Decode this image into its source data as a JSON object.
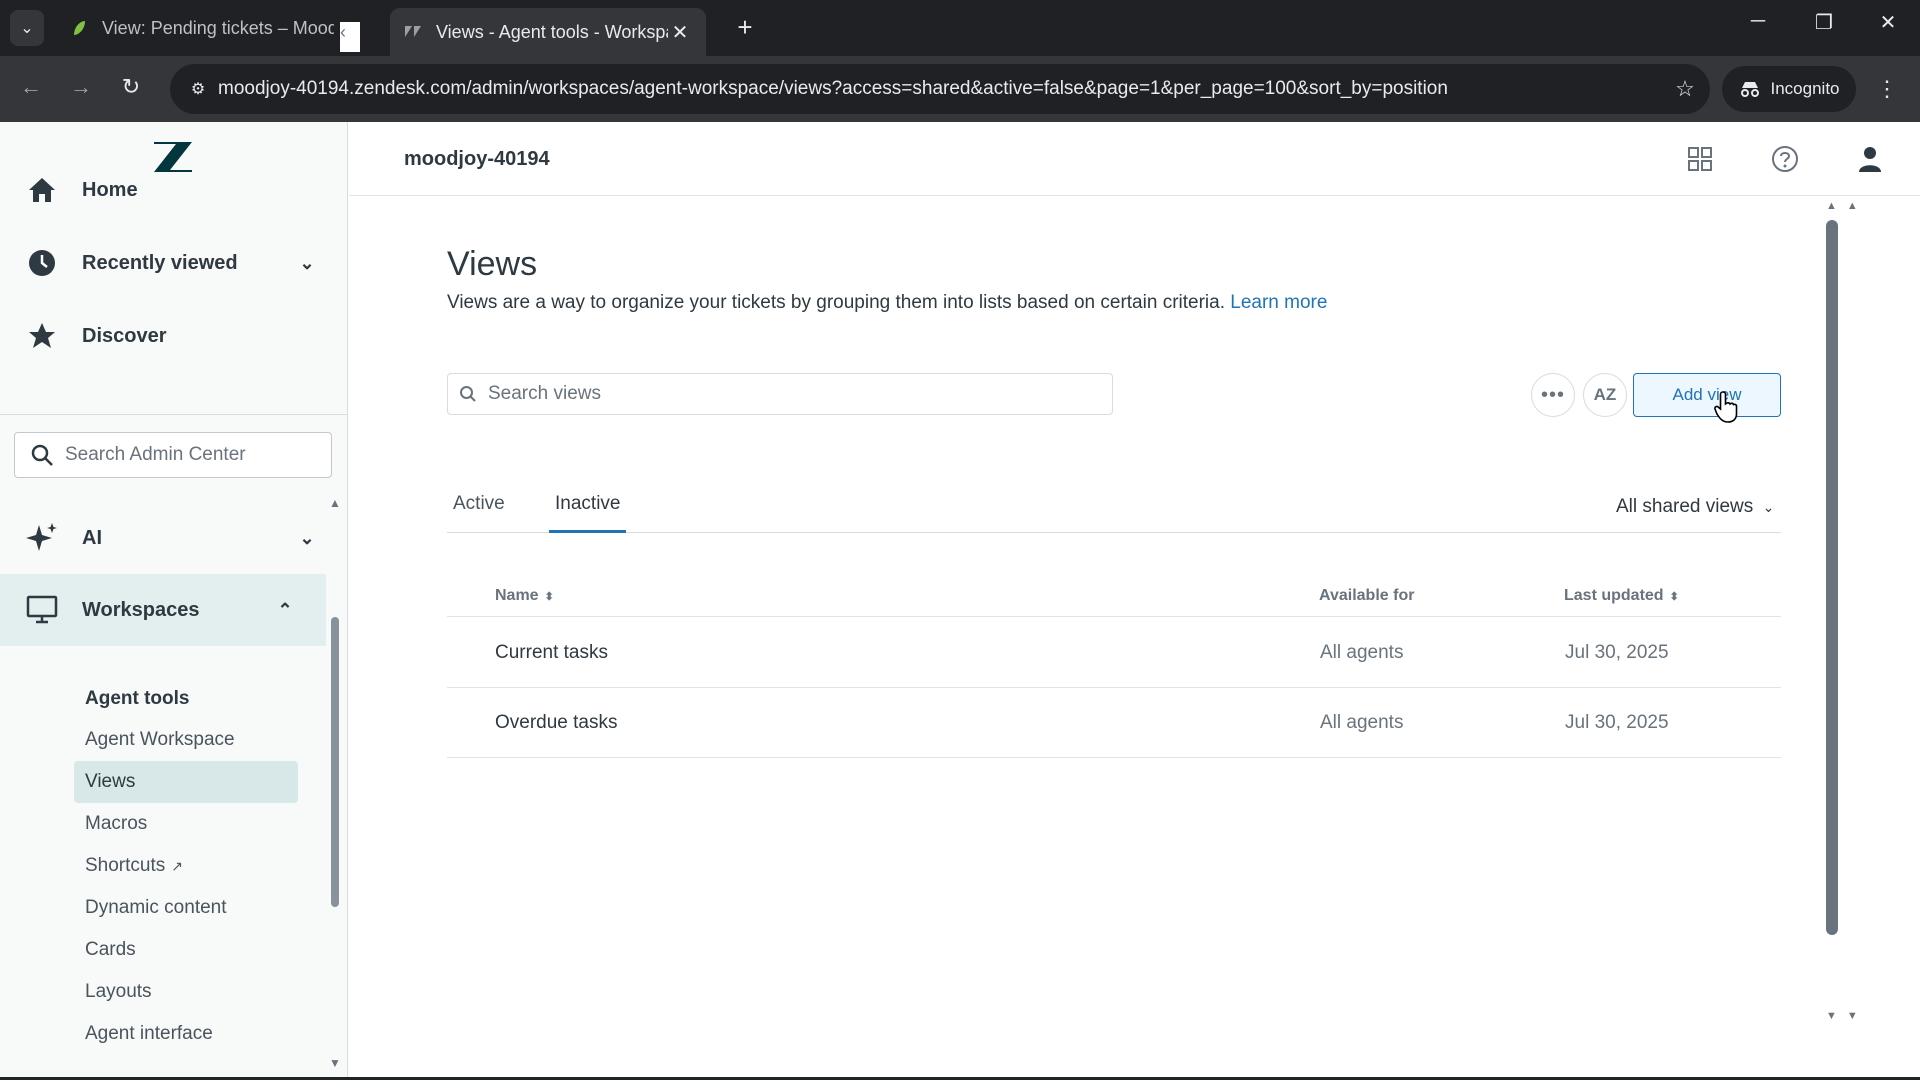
{
  "browser": {
    "tabs": [
      {
        "title": "View: Pending tickets – Moodjo"
      },
      {
        "title": "Views - Agent tools - Workspac"
      }
    ],
    "url": "moodjoy-40194.zendesk.com/admin/workspaces/agent-workspace/views?access=shared&active=false&page=1&per_page=100&sort_by=position",
    "incognito_label": "Incognito"
  },
  "sidebar": {
    "items": [
      {
        "label": "Home"
      },
      {
        "label": "Recently viewed"
      },
      {
        "label": "Discover"
      }
    ],
    "search_placeholder": "Search Admin Center",
    "sections": [
      {
        "label": "AI"
      },
      {
        "label": "Workspaces"
      }
    ],
    "subheading": "Agent tools",
    "subitems": [
      {
        "label": "Agent Workspace"
      },
      {
        "label": "Views"
      },
      {
        "label": "Macros"
      },
      {
        "label": "Shortcuts"
      },
      {
        "label": "Dynamic content"
      },
      {
        "label": "Cards"
      },
      {
        "label": "Layouts"
      },
      {
        "label": "Agent interface"
      }
    ]
  },
  "header": {
    "account": "moodjoy-40194"
  },
  "main": {
    "title": "Views",
    "description": "Views are a way to organize your tickets by grouping them into lists based on certain criteria.",
    "learn_more": "Learn more",
    "search_placeholder": "Search views",
    "sort_label": "AZ",
    "add_view": "Add view",
    "tabs": [
      {
        "label": "Active"
      },
      {
        "label": "Inactive"
      }
    ],
    "filter": "All shared views",
    "columns": {
      "name": "Name",
      "available_for": "Available for",
      "last_updated": "Last updated"
    },
    "rows": [
      {
        "name": "Current tasks",
        "available_for": "All agents",
        "last_updated": "Jul 30, 2025"
      },
      {
        "name": "Overdue tasks",
        "available_for": "All agents",
        "last_updated": "Jul 30, 2025"
      }
    ]
  },
  "colors": {
    "accent": "#1f73b7",
    "sidebar_bg": "#f8f9f9",
    "active_section_bg": "#e3eeee"
  }
}
